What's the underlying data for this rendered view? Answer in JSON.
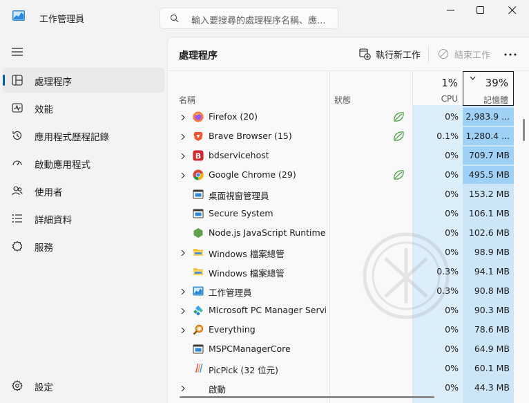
{
  "window": {
    "title": "工作管理員",
    "search_placeholder": "輸入要搜尋的處理程序名稱、應..."
  },
  "sidebar": {
    "items": [
      {
        "label": "處理程序",
        "icon": "processes-icon",
        "active": true
      },
      {
        "label": "效能",
        "icon": "performance-icon",
        "active": false
      },
      {
        "label": "應用程式歷程記錄",
        "icon": "history-icon",
        "active": false
      },
      {
        "label": "啟動應用程式",
        "icon": "startup-icon",
        "active": false
      },
      {
        "label": "使用者",
        "icon": "users-icon",
        "active": false
      },
      {
        "label": "詳細資料",
        "icon": "details-icon",
        "active": false
      },
      {
        "label": "服務",
        "icon": "services-icon",
        "active": false
      }
    ],
    "settings_label": "設定"
  },
  "main": {
    "title": "處理程序",
    "run_new_task_label": "執行新工作",
    "end_task_label": "結束工作",
    "columns": {
      "name": "名稱",
      "status": "狀態",
      "cpu_total": "1%",
      "cpu_label": "CPU",
      "memory_total": "39%",
      "memory_label": "記憶體"
    },
    "rows": [
      {
        "name": "Firefox (20)",
        "expandable": true,
        "icon": "firefox-icon",
        "eco": true,
        "cpu": "0%",
        "memory": "2,983.9 ...",
        "hot": true
      },
      {
        "name": "Brave Browser (15)",
        "expandable": true,
        "icon": "brave-icon",
        "eco": true,
        "cpu": "0.1%",
        "memory": "1,280.4 ...",
        "hot": true
      },
      {
        "name": "bdservicehost",
        "expandable": true,
        "icon": "bitdefender-icon",
        "eco": false,
        "cpu": "0%",
        "memory": "709.7 MB",
        "hot": true
      },
      {
        "name": "Google Chrome (29)",
        "expandable": true,
        "icon": "chrome-icon",
        "eco": true,
        "cpu": "0%",
        "memory": "495.5 MB",
        "hot": true
      },
      {
        "name": "桌面視窗管理員",
        "expandable": false,
        "icon": "system-window-icon",
        "eco": false,
        "cpu": "0%",
        "memory": "153.2 MB",
        "hot": false
      },
      {
        "name": "Secure System",
        "expandable": false,
        "icon": "system-window-icon",
        "eco": false,
        "cpu": "0%",
        "memory": "106.1 MB",
        "hot": false
      },
      {
        "name": "Node.js JavaScript Runtime ...",
        "expandable": false,
        "icon": "nodejs-icon",
        "eco": false,
        "cpu": "0%",
        "memory": "102.6 MB",
        "hot": false
      },
      {
        "name": "Windows 檔案總管",
        "expandable": true,
        "icon": "folder-icon",
        "eco": false,
        "cpu": "0%",
        "memory": "98.9 MB",
        "hot": false
      },
      {
        "name": "Windows 檔案總管",
        "expandable": false,
        "icon": "folder-icon",
        "eco": false,
        "cpu": "0.3%",
        "memory": "94.1 MB",
        "hot": false
      },
      {
        "name": "工作管理員",
        "expandable": true,
        "icon": "task-manager-icon",
        "eco": false,
        "cpu": "0.3%",
        "memory": "90.8 MB",
        "hot": false
      },
      {
        "name": "Microsoft PC Manager Servi...",
        "expandable": true,
        "icon": "pc-manager-icon",
        "eco": false,
        "cpu": "0%",
        "memory": "90.3 MB",
        "hot": false
      },
      {
        "name": "Everything",
        "expandable": true,
        "icon": "everything-icon",
        "eco": false,
        "cpu": "0%",
        "memory": "78.6 MB",
        "hot": false
      },
      {
        "name": "MSPCManagerCore",
        "expandable": false,
        "icon": "system-window-icon",
        "eco": false,
        "cpu": "0%",
        "memory": "64.9 MB",
        "hot": false
      },
      {
        "name": "PicPick (32 位元)",
        "expandable": false,
        "icon": "picpick-icon",
        "eco": false,
        "cpu": "0%",
        "memory": "60.1 MB",
        "hot": false
      },
      {
        "name": "啟動",
        "expandable": true,
        "icon": "",
        "eco": false,
        "cpu": "0%",
        "memory": "44.3 MB",
        "hot": false
      }
    ]
  },
  "colors": {
    "accent": "#005fb8",
    "cpu_column": "#ddeefb",
    "memory_column": "#cce5f7",
    "memory_hot": "#9fd0f5",
    "eco_leaf": "#3a9b3a"
  }
}
